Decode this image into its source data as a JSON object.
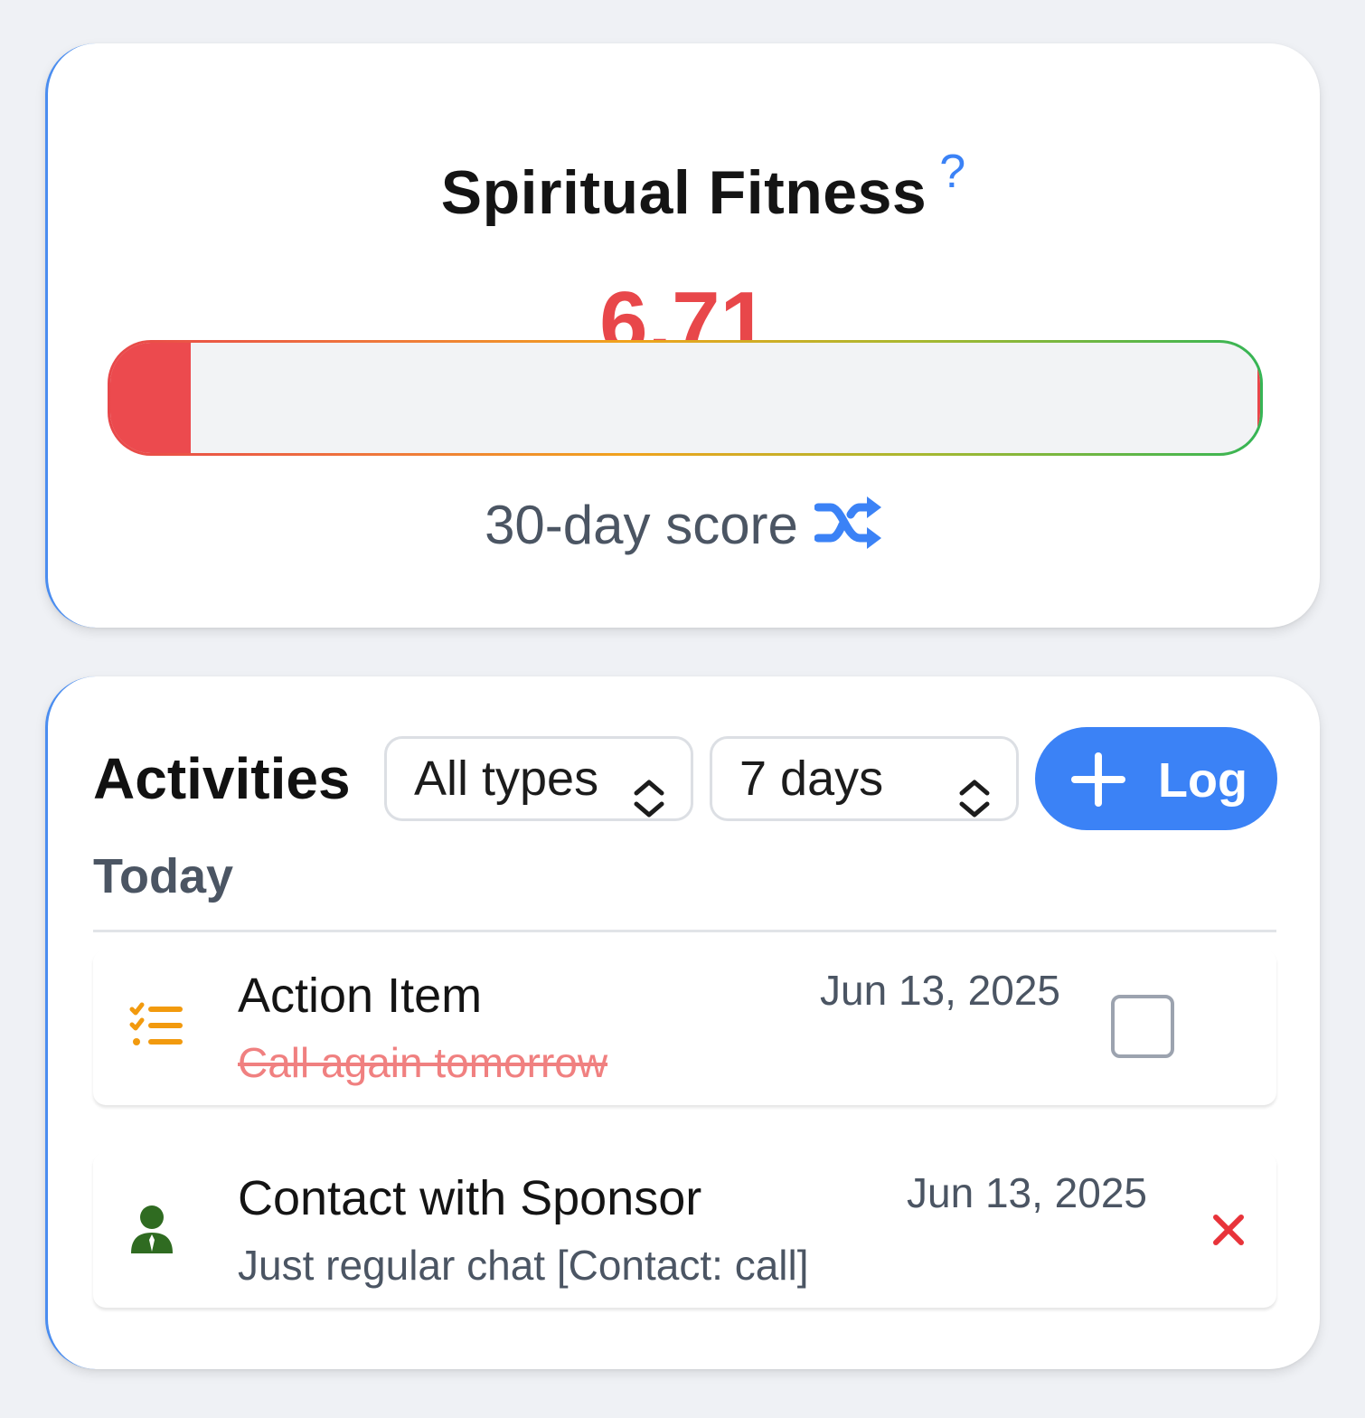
{
  "fitness": {
    "title": "Spiritual Fitness",
    "help_glyph": "?",
    "score": "6.71",
    "score_fraction": 0.07,
    "subtitle": "30-day score",
    "score_color": "#e8474a"
  },
  "activities": {
    "title": "Activities",
    "type_filter": "All types",
    "range_filter": "7 days",
    "log_button": "Log",
    "section": "Today",
    "items": [
      {
        "type": "Action Item",
        "description": "Call again tomorrow",
        "date": "Jun 13, 2025",
        "icon": "checklist-icon",
        "completed": false
      },
      {
        "type": "Contact with Sponsor",
        "description": "Just regular chat [Contact: call]",
        "date": "Jun 13, 2025",
        "icon": "sponsor-person-icon"
      }
    ]
  },
  "colors": {
    "accent": "#3b82f6",
    "danger": "#e8474a",
    "action_icon": "#f29a0e",
    "sponsor_icon": "#2f6b21"
  }
}
